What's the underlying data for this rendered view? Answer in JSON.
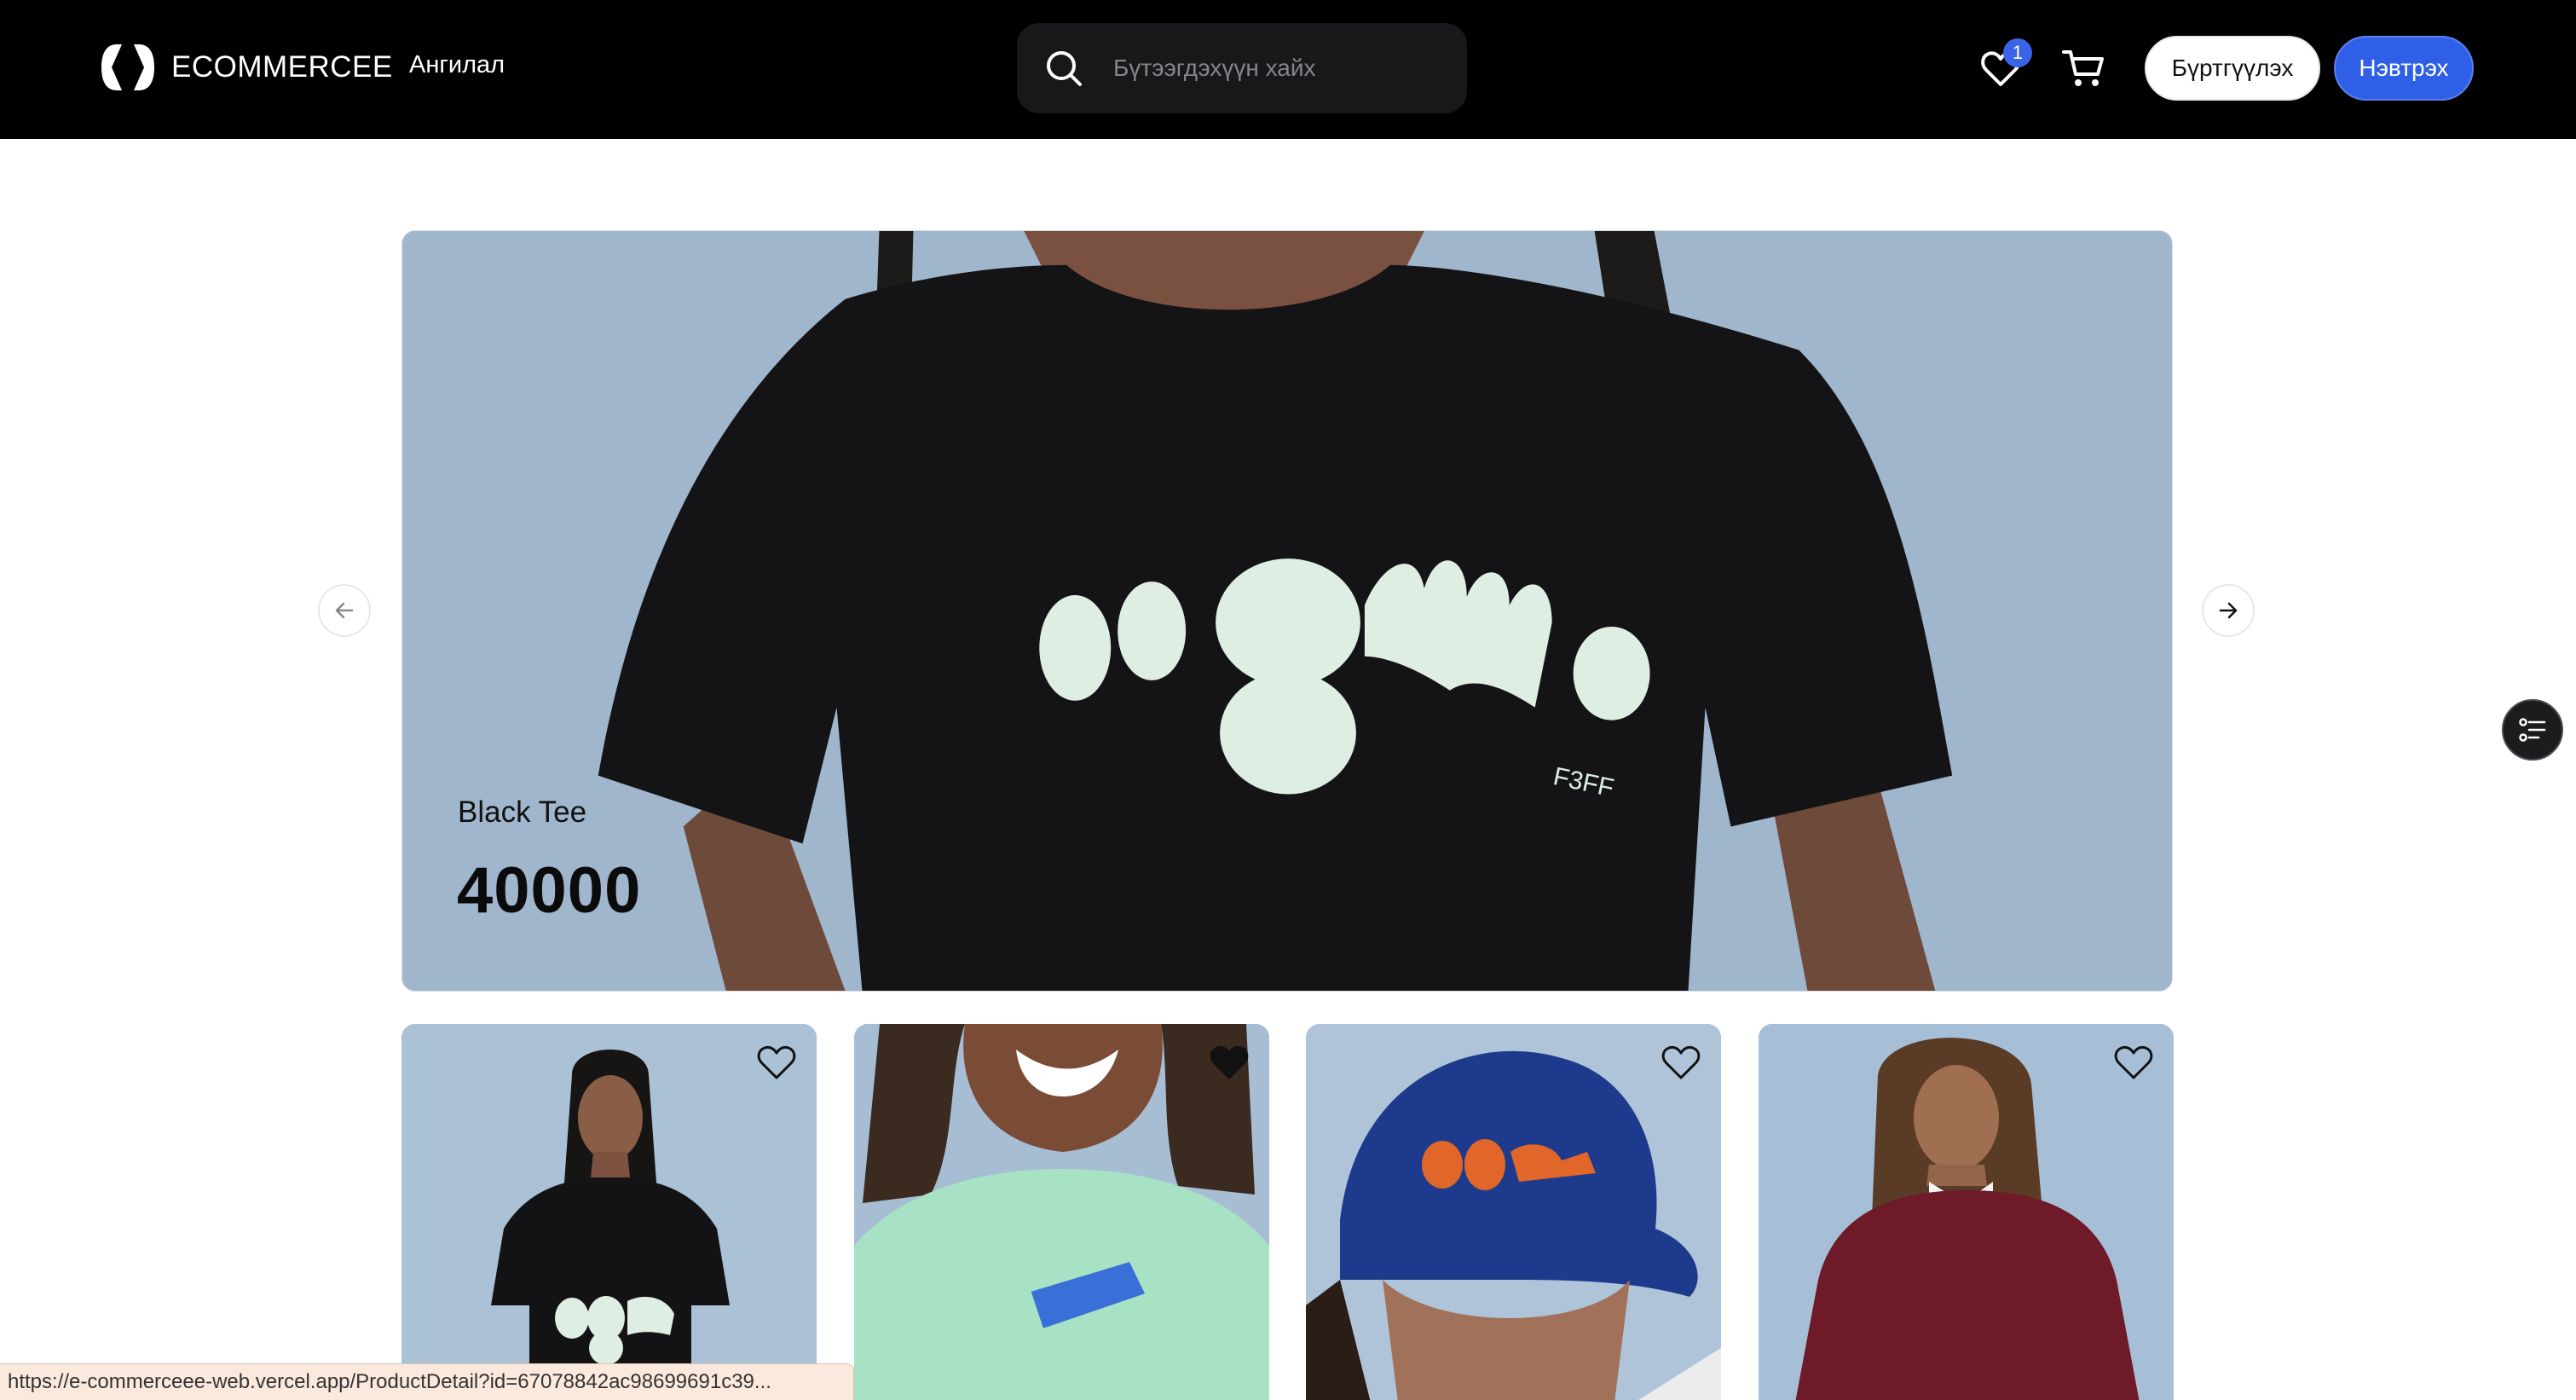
{
  "header": {
    "brand_name": "ECOMMERCEE",
    "nav_category": "Ангилал",
    "search_placeholder": "Бүтээгдэхүүн хайх",
    "wishlist_count": "1",
    "register_label": "Бүртгүүлэх",
    "login_label": "Нэвтрэх",
    "icons": [
      "brand-logo-icon",
      "search-icon",
      "heart-icon",
      "cart-icon"
    ]
  },
  "hero": {
    "title": "Black Tee",
    "price": "40000",
    "shirt_print": "F3FF",
    "prev_icon": "arrow-left-icon",
    "next_icon": "arrow-right-icon"
  },
  "products": [
    {
      "image": "woman in black tee",
      "favorited": false
    },
    {
      "image": "smiling woman in mint tee",
      "favorited": true
    },
    {
      "image": "blue cap with orange logo",
      "favorited": false
    },
    {
      "image": "woman in maroon sweatshirt",
      "favorited": false
    }
  ],
  "filter_button_icon": "filter-list-icon",
  "status_url": "https://e-commerceee-web.vercel.app/ProductDetail?id=67078842ac98699691c39...",
  "colors": {
    "header_bg": "#000000",
    "accent": "#2f5fe6",
    "badge": "#3b63e8",
    "hero_bg": "#9fb6cc"
  }
}
